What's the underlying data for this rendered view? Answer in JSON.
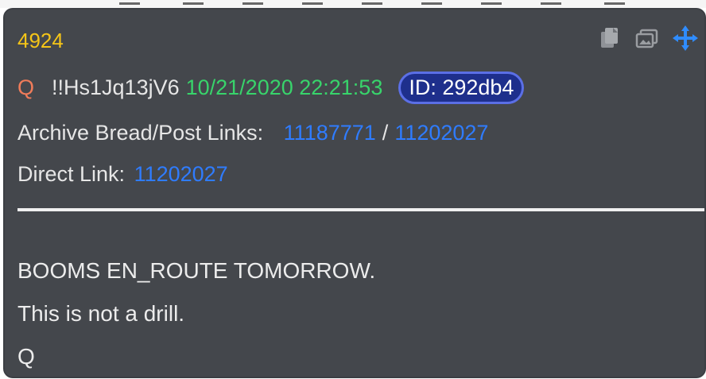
{
  "post": {
    "number": "4924",
    "author": "Q",
    "tripcode": "!!Hs1Jq13jV6",
    "datetime": "10/21/2020 22:21:53",
    "id_label": "ID: 292db4",
    "archive_label": "Archive Bread/Post Links:",
    "archive_bread_link": "11187771",
    "archive_separator": "/",
    "archive_post_link": "11202027",
    "direct_label": "Direct Link:",
    "direct_link": "11202027",
    "message_lines": [
      "BOOMS EN_ROUTE TOMORROW.",
      "This is not a drill.",
      "Q"
    ]
  },
  "toolbar": {
    "icons": [
      "copy-icon",
      "image-icon",
      "move-icon"
    ]
  },
  "colors": {
    "card_background": "#44474c",
    "post_number": "#f5c518",
    "author": "#f07c5a",
    "datetime": "#38d46b",
    "link": "#2f7cff",
    "id_badge_background": "#1e2f8c",
    "id_badge_border": "#5b6fe6",
    "text": "#e6e6e6"
  }
}
